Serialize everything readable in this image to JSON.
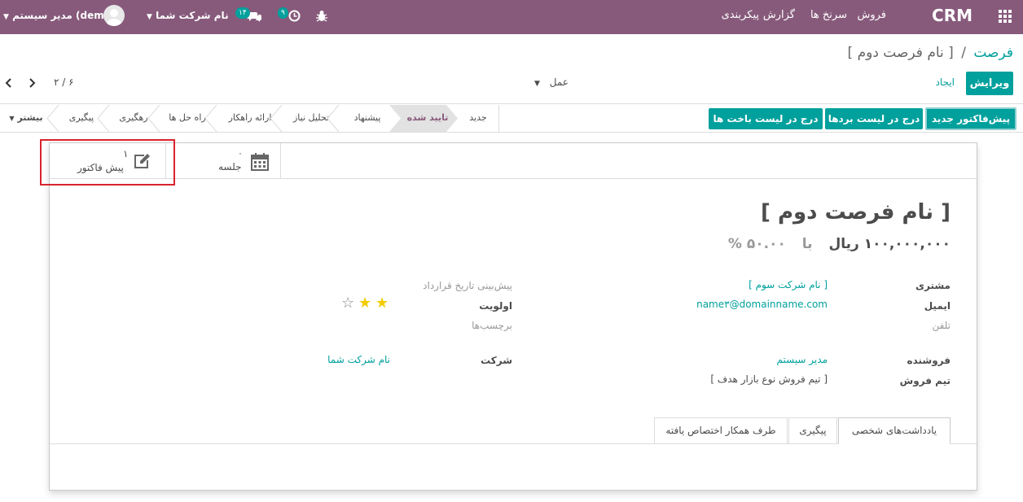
{
  "navbar": {
    "app_title": "CRM",
    "menu": [
      "فروش",
      "سرنخ ها",
      "گزارش",
      "پیکربندی"
    ],
    "company_switcher": "نام شرکت شما",
    "user_name": "مدیر سیستم (demo)",
    "messages_count": "۱۴",
    "activities_count": "۹"
  },
  "breadcrumb": {
    "parent": "فرصت",
    "separator": "/",
    "current": "[ نام فرصت دوم ]"
  },
  "actions": {
    "edit": "ویرایش",
    "create": "ایجاد",
    "action_menu": "عمل"
  },
  "pager": {
    "value": "۲ / ۶"
  },
  "header_buttons": {
    "new_quotation": "پیش‌فاکتور جدید",
    "mark_won": "درج در لیست بردها",
    "mark_lost": "درج در لیست باخت ها"
  },
  "stages": [
    "جدید",
    "تایید شده",
    "پیشنهاد",
    "تحلیل نیاز",
    "ارائه راهکار",
    "راه حل ها",
    "رهگیری",
    "پیگیری"
  ],
  "active_stage": "تایید شده",
  "more_label": "بیشتر",
  "smart_buttons": {
    "meeting_count": "۰",
    "meeting_label": "جلسه",
    "quotation_count": "۱",
    "quotation_label": "پیش فاکتور"
  },
  "record": {
    "title": "[ نام فرصت دوم ]",
    "revenue": "۱۰۰,۰۰۰,۰۰۰ ریال",
    "at_label": "با",
    "probability": "۵۰.۰۰ %"
  },
  "fields_right": {
    "customer_label": "مشتری",
    "customer_value": "[ نام شرکت سوم ]",
    "email_label": "ایمیل",
    "email_value": "name۳@domainname.com",
    "phone_label": "تلفن",
    "salesperson_label": "فروشنده",
    "salesperson_value": "مدیر سیستم",
    "team_label": "تیم فروش",
    "team_value": "[ تیم فروش نوع بازار هدف ]"
  },
  "fields_left": {
    "expected_closing_label": "پیش‌بینی تاریخ قرارداد",
    "priority_label": "اولویت",
    "priority_stars": 2,
    "priority_max": 3,
    "tags_label": "برچسب‌ها",
    "company_label": "شرکت",
    "company_value": "نام شرکت شما"
  },
  "tabs": [
    "یادداشت‌های شخصی",
    "پیگیری",
    "طرف همکار اختصاص یافته"
  ],
  "colors": {
    "navbar": "#875a7b",
    "primary": "#00a09d",
    "star": "#f3cc00",
    "highlight": "#d9232d"
  }
}
